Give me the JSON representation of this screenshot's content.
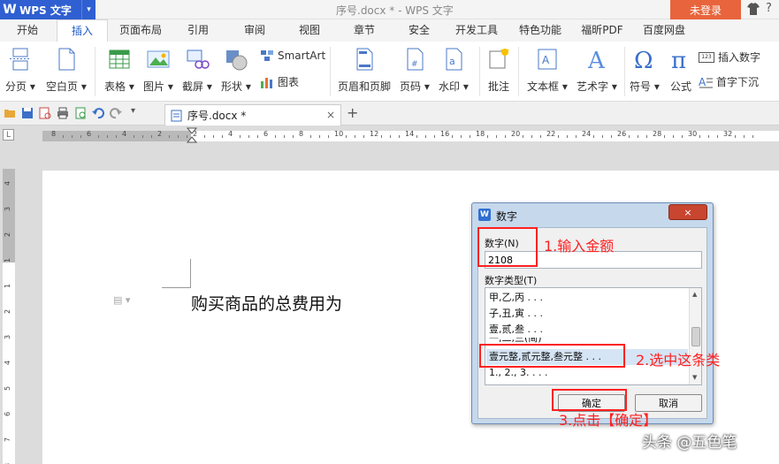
{
  "titlebar": {
    "app_logo": "W",
    "app_name": "WPS 文字",
    "doc_title": "序号.docx * - WPS 文字",
    "login": "未登录",
    "help": "?"
  },
  "menu_tabs": [
    "开始",
    "插入",
    "页面布局",
    "引用",
    "审阅",
    "视图",
    "章节",
    "安全",
    "开发工具",
    "特色功能",
    "福昕PDF",
    "百度网盘"
  ],
  "active_tab": "插入",
  "ribbon": {
    "page_break": "分页",
    "blank_page": "空白页",
    "table": "表格",
    "picture": "图片",
    "screenshot": "截屏",
    "shape": "形状",
    "smartart": "SmartArt",
    "chart": "图表",
    "header_footer": "页眉和页脚",
    "page_number": "页码",
    "watermark": "水印",
    "comment": "批注",
    "textbox": "文本框",
    "wordart": "艺术字",
    "symbol": "符号",
    "formula": "公式",
    "insert_number": "插入数字",
    "drop_cap": "首字下沉",
    "number_icon_text": "123"
  },
  "document_tab": {
    "name": "序号.docx *",
    "close": "×",
    "new_tab": "+"
  },
  "ruler": {
    "corner": "L",
    "h_numbers": [
      "8",
      "6",
      "4",
      "2",
      "2",
      "4",
      "6",
      "8",
      "10",
      "12",
      "14",
      "16",
      "18",
      "20",
      "22",
      "24",
      "26",
      "28",
      "30",
      "32"
    ],
    "v_numbers": [
      "4",
      "3",
      "2",
      "1",
      "1",
      "2",
      "3",
      "4",
      "5",
      "6",
      "7",
      "8"
    ]
  },
  "document": {
    "body_text": "购买商品的总费用为"
  },
  "dialog": {
    "icon": "W",
    "title": "数字",
    "close": "×",
    "number_label": "数字(N)",
    "number_value": "2108",
    "type_label": "数字类型(T)",
    "types": [
      "甲,乙,丙 . . .",
      "子,丑,寅 . . .",
      "壹,贰,叁 . . .",
      "一,二,三(简)",
      "壹元整,贰元整,叁元整 . . .",
      "1., 2., 3. . . ."
    ],
    "selected_type": "壹元整,贰元整,叁元整 . . .",
    "ok": "确定",
    "cancel": "取消"
  },
  "annotations": {
    "step1": "1.输入金额",
    "step2": "2.选中这条类",
    "step3": "3.点击【确定】",
    "color": "#ff2020"
  },
  "watermark": "头条 @五色笔"
}
